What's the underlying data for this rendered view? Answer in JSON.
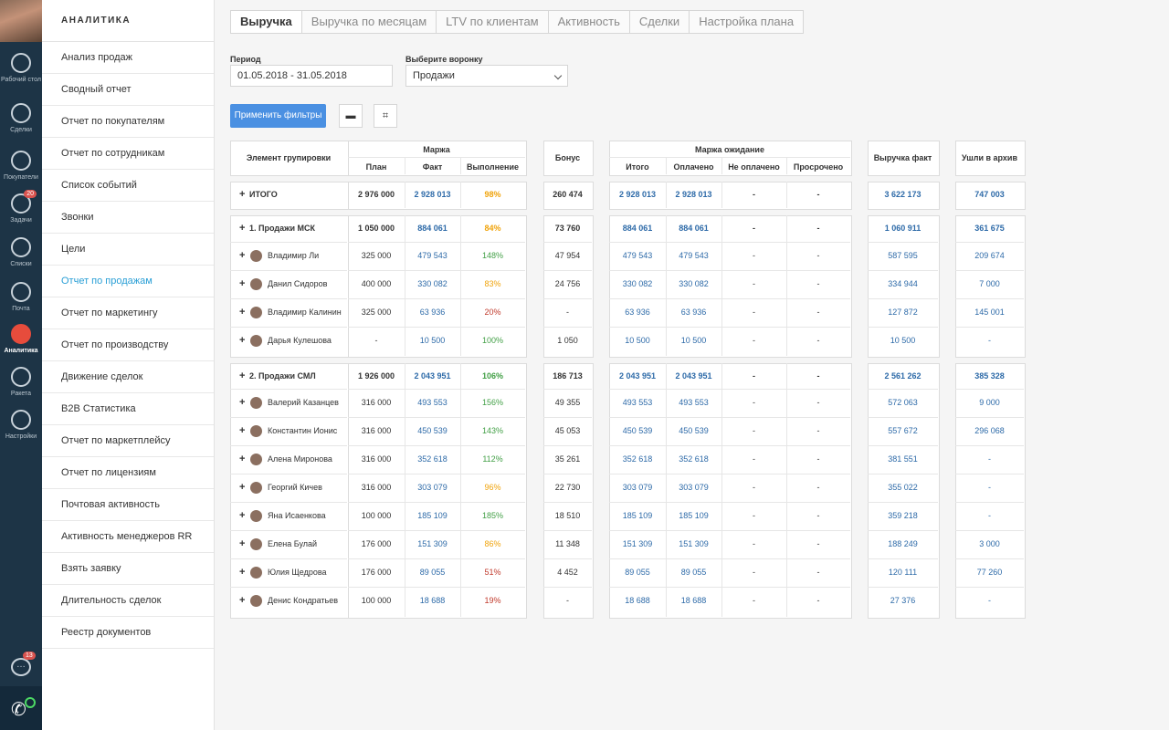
{
  "nav": {
    "items": [
      {
        "label": "Рабочий стол",
        "icon": "dashboard-icon"
      },
      {
        "label": "Сделки",
        "icon": "dollar-icon"
      },
      {
        "label": "Покупатели",
        "icon": "customers-icon"
      },
      {
        "label": "Задачи",
        "icon": "tasks-icon",
        "badge": "20"
      },
      {
        "label": "Списки",
        "icon": "lists-icon"
      },
      {
        "label": "Почта",
        "icon": "mail-icon"
      },
      {
        "label": "Аналитика",
        "icon": "analytics-icon",
        "active": true
      },
      {
        "label": "Ракета",
        "icon": "rocket-icon"
      },
      {
        "label": "Настройки",
        "icon": "settings-icon"
      }
    ],
    "chat_badge": "13"
  },
  "sidebar": {
    "title": "АНАЛИТИКА",
    "items": [
      "Анализ продаж",
      "Сводный отчет",
      "Отчет по покупателям",
      "Отчет по сотрудникам",
      "Список событий",
      "Звонки",
      "Цели",
      "Отчет по продажам",
      "Отчет по маркетингу",
      "Отчет по производству",
      "Движение сделок",
      "B2B Статистика",
      "Отчет по маркетплейсу",
      "Отчет по лицензиям",
      "Почтовая активность",
      "Активность менеджеров RR",
      "Взять заявку",
      "Длительность сделок",
      "Реестр документов"
    ],
    "active_index": 7
  },
  "tabs": [
    "Выручка",
    "Выручка по месяцам",
    "LTV по клиентам",
    "Активность",
    "Сделки",
    "Настройка плана"
  ],
  "filters": {
    "period_label": "Период",
    "period_value": "01.05.2018 - 31.05.2018",
    "funnel_label": "Выберите воронку",
    "funnel_value": "Продажи",
    "apply_label": "Применить фильтры"
  },
  "table": {
    "headers": {
      "group": "Элемент групировки",
      "margin": "Маржа",
      "plan": "План",
      "fact": "Факт",
      "done": "Выполнение",
      "bonus": "Бонус",
      "margin_wait": "Маржа ожидание",
      "total": "Итого",
      "paid": "Оплачено",
      "unpaid": "Не оплачено",
      "overdue": "Просрочено",
      "revenue": "Выручка факт",
      "archive": "Ушли в архив"
    },
    "total": {
      "name": "ИТОГО",
      "plan": "2 976 000",
      "fact": "2 928 013",
      "done": "98%",
      "bonus": "260 474",
      "total": "2 928 013",
      "paid": "2 928 013",
      "unpaid": "-",
      "overdue": "-",
      "revenue": "3 622 173",
      "archive": "747 003"
    },
    "groups": [
      {
        "name": "1. Продажи МСК",
        "plan": "1 050 000",
        "fact": "884 061",
        "done": "84%",
        "bonus": "73 760",
        "total": "884 061",
        "paid": "884 061",
        "unpaid": "-",
        "overdue": "-",
        "revenue": "1 060 911",
        "archive": "361 675",
        "rows": [
          {
            "name": "Владимир Ли",
            "plan": "325 000",
            "fact": "479 543",
            "done": "148%",
            "bonus": "47 954",
            "total": "479 543",
            "paid": "479 543",
            "unpaid": "-",
            "overdue": "-",
            "revenue": "587 595",
            "archive": "209 674"
          },
          {
            "name": "Данил Сидоров",
            "plan": "400 000",
            "fact": "330 082",
            "done": "83%",
            "bonus": "24 756",
            "total": "330 082",
            "paid": "330 082",
            "unpaid": "-",
            "overdue": "-",
            "revenue": "334 944",
            "archive": "7 000"
          },
          {
            "name": "Владимир Калинин",
            "plan": "325 000",
            "fact": "63 936",
            "done": "20%",
            "bonus": "-",
            "total": "63 936",
            "paid": "63 936",
            "unpaid": "-",
            "overdue": "-",
            "revenue": "127 872",
            "archive": "145 001"
          },
          {
            "name": "Дарья Кулешова",
            "plan": "-",
            "fact": "10 500",
            "done": "100%",
            "bonus": "1 050",
            "total": "10 500",
            "paid": "10 500",
            "unpaid": "-",
            "overdue": "-",
            "revenue": "10 500",
            "archive": "-"
          }
        ]
      },
      {
        "name": "2. Продажи СМЛ",
        "plan": "1 926 000",
        "fact": "2 043 951",
        "done": "106%",
        "bonus": "186 713",
        "total": "2 043 951",
        "paid": "2 043 951",
        "unpaid": "-",
        "overdue": "-",
        "revenue": "2 561 262",
        "archive": "385 328",
        "rows": [
          {
            "name": "Валерий Казанцев",
            "plan": "316 000",
            "fact": "493 553",
            "done": "156%",
            "bonus": "49 355",
            "total": "493 553",
            "paid": "493 553",
            "unpaid": "-",
            "overdue": "-",
            "revenue": "572 063",
            "archive": "9 000"
          },
          {
            "name": "Константин Ионис",
            "plan": "316 000",
            "fact": "450 539",
            "done": "143%",
            "bonus": "45 053",
            "total": "450 539",
            "paid": "450 539",
            "unpaid": "-",
            "overdue": "-",
            "revenue": "557 672",
            "archive": "296 068"
          },
          {
            "name": "Алена Миронова",
            "plan": "316 000",
            "fact": "352 618",
            "done": "112%",
            "bonus": "35 261",
            "total": "352 618",
            "paid": "352 618",
            "unpaid": "-",
            "overdue": "-",
            "revenue": "381 551",
            "archive": "-"
          },
          {
            "name": "Георгий Кичев",
            "plan": "316 000",
            "fact": "303 079",
            "done": "96%",
            "bonus": "22 730",
            "total": "303 079",
            "paid": "303 079",
            "unpaid": "-",
            "overdue": "-",
            "revenue": "355 022",
            "archive": "-"
          },
          {
            "name": "Яна Исаенкова",
            "plan": "100 000",
            "fact": "185 109",
            "done": "185%",
            "bonus": "18 510",
            "total": "185 109",
            "paid": "185 109",
            "unpaid": "-",
            "overdue": "-",
            "revenue": "359 218",
            "archive": "-"
          },
          {
            "name": "Елена Булай",
            "plan": "176 000",
            "fact": "151 309",
            "done": "86%",
            "bonus": "11 348",
            "total": "151 309",
            "paid": "151 309",
            "unpaid": "-",
            "overdue": "-",
            "revenue": "188 249",
            "archive": "3 000"
          },
          {
            "name": "Юлия Щедрова",
            "plan": "176 000",
            "fact": "89 055",
            "done": "51%",
            "bonus": "4 452",
            "total": "89 055",
            "paid": "89 055",
            "unpaid": "-",
            "overdue": "-",
            "revenue": "120 111",
            "archive": "77 260"
          },
          {
            "name": "Денис Кондратьев",
            "plan": "100 000",
            "fact": "18 688",
            "done": "19%",
            "bonus": "-",
            "total": "18 688",
            "paid": "18 688",
            "unpaid": "-",
            "overdue": "-",
            "revenue": "27 376",
            "archive": "-"
          }
        ]
      }
    ]
  },
  "colors": {
    "accent": "#2a9fd6",
    "nav_bg": "#1d3446",
    "link_blue": "#2d6aa8",
    "good": "#43a047",
    "warn": "#f0a30a",
    "bad": "#c0392b"
  }
}
